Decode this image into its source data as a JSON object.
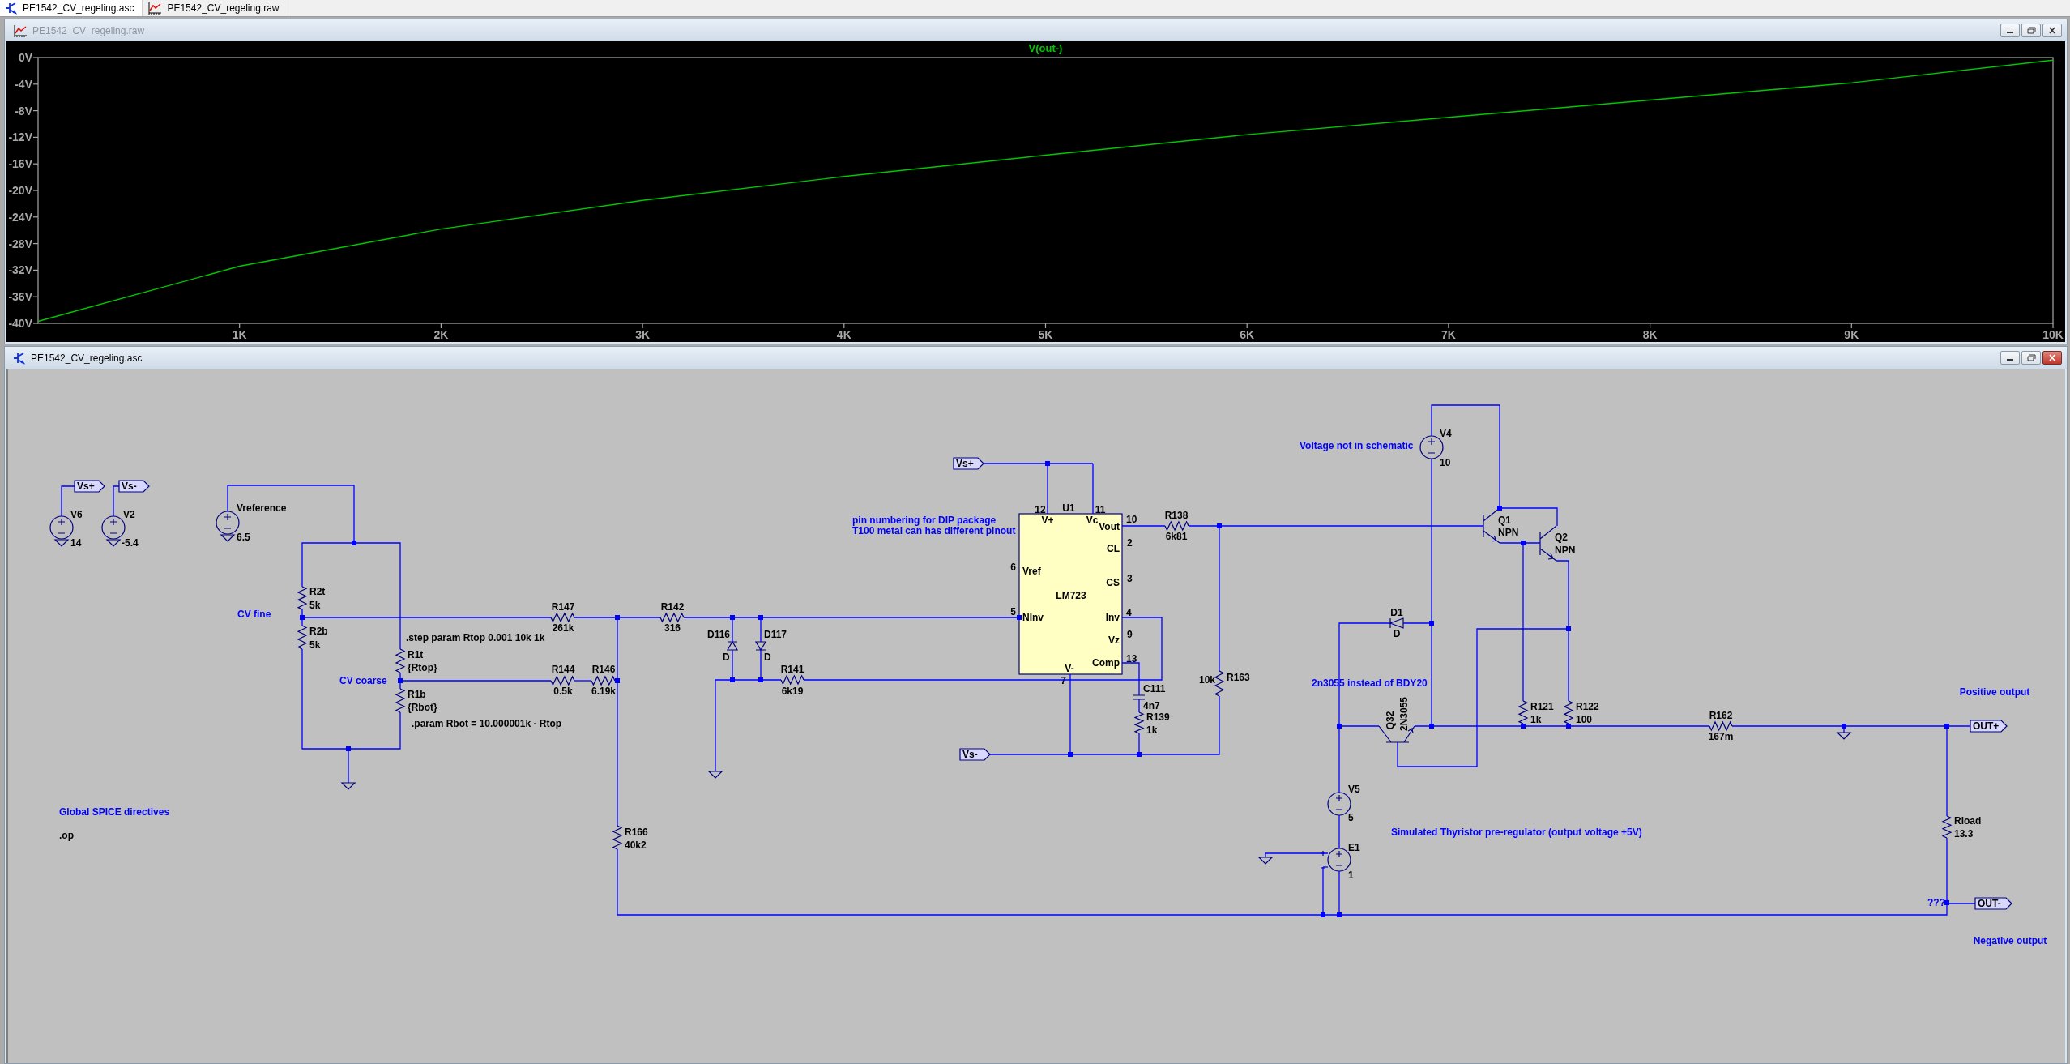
{
  "tabs": [
    {
      "label": "PE1542_CV_regeling.asc",
      "kind": "schematic",
      "selected": true
    },
    {
      "label": "PE1542_CV_regeling.raw",
      "kind": "waveform",
      "selected": false
    }
  ],
  "plot_window": {
    "title": "PE1542_CV_regeling.raw",
    "kind": "waveform",
    "active": false,
    "chart_data": {
      "type": "line",
      "x": [
        0,
        1000,
        2000,
        3000,
        4000,
        5000,
        6000,
        7000,
        8000,
        9000,
        10000
      ],
      "series": [
        {
          "name": "V(out-)",
          "color": "#00c800",
          "values": [
            -39.7,
            -31.4,
            -25.8,
            -21.5,
            -17.9,
            -14.7,
            -11.6,
            -9.0,
            -6.4,
            -3.8,
            -0.4
          ]
        }
      ],
      "xlim": [
        0,
        10000
      ],
      "ylim": [
        -40,
        0
      ],
      "xticks": [
        {
          "value": 1000,
          "label": "1K"
        },
        {
          "value": 2000,
          "label": "2K"
        },
        {
          "value": 3000,
          "label": "3K"
        },
        {
          "value": 4000,
          "label": "4K"
        },
        {
          "value": 5000,
          "label": "5K"
        },
        {
          "value": 6000,
          "label": "6K"
        },
        {
          "value": 7000,
          "label": "7K"
        },
        {
          "value": 8000,
          "label": "8K"
        },
        {
          "value": 9000,
          "label": "9K"
        },
        {
          "value": 10000,
          "label": "10K"
        }
      ],
      "yticks": [
        {
          "value": 0,
          "label": "0V"
        },
        {
          "value": -4,
          "label": "-4V"
        },
        {
          "value": -8,
          "label": "-8V"
        },
        {
          "value": -12,
          "label": "-12V"
        },
        {
          "value": -16,
          "label": "-16V"
        },
        {
          "value": -20,
          "label": "-20V"
        },
        {
          "value": -24,
          "label": "-24V"
        },
        {
          "value": -28,
          "label": "-28V"
        },
        {
          "value": -32,
          "label": "-32V"
        },
        {
          "value": -36,
          "label": "-36V"
        },
        {
          "value": -40,
          "label": "-40V"
        }
      ]
    }
  },
  "schematic_window": {
    "title": "PE1542_CV_regeling.asc",
    "kind": "schematic",
    "active": true,
    "components": [
      {
        "kind": "source",
        "name": "V6",
        "value": "14"
      },
      {
        "kind": "source",
        "name": "V2",
        "value": "-5.4"
      },
      {
        "kind": "source",
        "name": "Vreference",
        "value": "6.5"
      },
      {
        "kind": "resistor",
        "name": "R2t",
        "value": "5k"
      },
      {
        "kind": "resistor",
        "name": "R2b",
        "value": "5k"
      },
      {
        "kind": "resistor",
        "name": "R1t",
        "value": "{Rtop}"
      },
      {
        "kind": "resistor",
        "name": "R1b",
        "value": "{Rbot}"
      },
      {
        "kind": "resistor",
        "name": "R147",
        "value": "261k"
      },
      {
        "kind": "resistor",
        "name": "R142",
        "value": "316"
      },
      {
        "kind": "resistor",
        "name": "R144",
        "value": "0.5k"
      },
      {
        "kind": "resistor",
        "name": "R146",
        "value": "6.19k"
      },
      {
        "kind": "resistor",
        "name": "R166",
        "value": "40k2"
      },
      {
        "kind": "diode",
        "name": "D116",
        "value": "D"
      },
      {
        "kind": "diode",
        "name": "D117",
        "value": "D"
      },
      {
        "kind": "resistor",
        "name": "R141",
        "value": "6k19"
      },
      {
        "kind": "resistor",
        "name": "R138",
        "value": "6k81"
      },
      {
        "kind": "resistor",
        "name": "R163",
        "value": "10k"
      },
      {
        "kind": "capacitor",
        "name": "C111",
        "value": "4n7"
      },
      {
        "kind": "resistor",
        "name": "R139",
        "value": "1k"
      },
      {
        "kind": "source",
        "name": "V4",
        "value": "10"
      },
      {
        "kind": "npn",
        "name": "Q1",
        "value": "NPN"
      },
      {
        "kind": "npn",
        "name": "Q2",
        "value": "NPN"
      },
      {
        "kind": "resistor",
        "name": "R121",
        "value": "1k"
      },
      {
        "kind": "resistor",
        "name": "R122",
        "value": "100"
      },
      {
        "kind": "npn",
        "name": "Q32",
        "value": "2N3055"
      },
      {
        "kind": "diode",
        "name": "D1",
        "value": "D"
      },
      {
        "kind": "resistor",
        "name": "R162",
        "value": "167m"
      },
      {
        "kind": "source",
        "name": "V5",
        "value": "5"
      },
      {
        "kind": "vcvs",
        "name": "E1",
        "value": "1"
      },
      {
        "kind": "resistor",
        "name": "Rload",
        "value": "13.3"
      }
    ],
    "chip": {
      "name": "U1",
      "part": "LM723",
      "pins": [
        {
          "number": "12",
          "name": "V+"
        },
        {
          "number": "11",
          "name": "Vc"
        },
        {
          "number": "10",
          "name": "Vout"
        },
        {
          "number": "2",
          "name": "CL"
        },
        {
          "number": "3",
          "name": "CS"
        },
        {
          "number": "6",
          "name": "Vref"
        },
        {
          "number": "5",
          "name": "NInv"
        },
        {
          "number": "4",
          "name": "Inv"
        },
        {
          "number": "9",
          "name": "Vz"
        },
        {
          "number": "13",
          "name": "Comp"
        },
        {
          "number": "7",
          "name": "V-"
        }
      ]
    },
    "net_labels": [
      {
        "text": "Vs+"
      },
      {
        "text": "Vs-"
      },
      {
        "text": "Vs+"
      },
      {
        "text": "Vs-"
      },
      {
        "text": "OUT+"
      },
      {
        "text": "OUT-"
      }
    ],
    "comments": [
      {
        "text": "CV fine"
      },
      {
        "text": "CV coarse"
      },
      {
        "text": "pin numbering for DIP package"
      },
      {
        "text": "T100 metal can has different pinout"
      },
      {
        "text": "Voltage not in schematic"
      },
      {
        "text": "2n3055 instead of BDY20"
      },
      {
        "text": "Simulated Thyristor pre-regulator (output voltage +5V)"
      },
      {
        "text": "Positive output"
      },
      {
        "text": "Negative output"
      },
      {
        "text": "Global SPICE directives"
      },
      {
        "text": "???"
      }
    ],
    "directives": [
      {
        "text": ".step param Rtop 0.001 10k 1k"
      },
      {
        "text": ".param Rbot = 10.000001k - Rtop"
      },
      {
        "text": ".op"
      }
    ]
  }
}
